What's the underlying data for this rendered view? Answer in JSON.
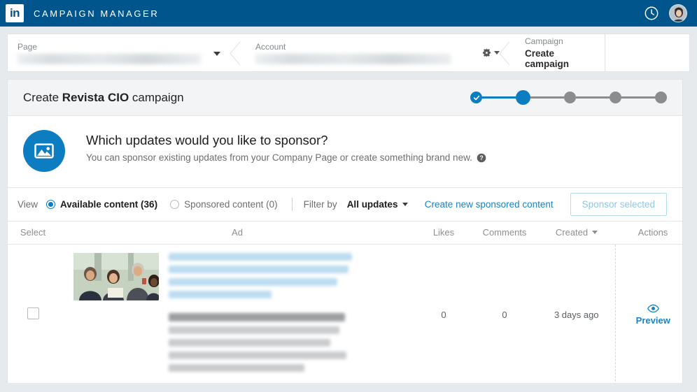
{
  "appbar": {
    "logo_text": "in",
    "title": "CAMPAIGN MANAGER",
    "clock_icon": "clock-icon",
    "avatar_icon": "user-avatar"
  },
  "breadcrumb": {
    "page": {
      "label": "Page",
      "value": "",
      "redacted": true,
      "caret_icon": "chevron-down-icon"
    },
    "account": {
      "label": "Account",
      "value": "",
      "redacted": true,
      "gear_icon": "gear-icon"
    },
    "campaign": {
      "label": "Campaign",
      "value": "Create campaign"
    }
  },
  "card_header": {
    "title_prefix": "Create ",
    "title_brand": "Revista CIO",
    "title_suffix": " campaign",
    "steps": [
      {
        "state": "done",
        "icon": "check-icon"
      },
      {
        "state": "active"
      },
      {
        "state": "pending"
      },
      {
        "state": "pending"
      },
      {
        "state": "pending"
      }
    ]
  },
  "prompt": {
    "icon": "image-icon",
    "heading": "Which updates would you like to sponsor?",
    "subtext": "You can sponsor existing updates from your Company Page or create something brand new.",
    "help_icon": "help-circle-icon"
  },
  "toolbar": {
    "view_label": "View",
    "options": [
      {
        "label": "Available content (36)",
        "selected": true
      },
      {
        "label": "Sponsored content (0)",
        "selected": false
      }
    ],
    "filter_label": "Filter by",
    "filter_value": "All updates",
    "filter_caret_icon": "chevron-down-icon",
    "create_link": "Create new sponsored content",
    "sponsor_button": "Sponsor selected",
    "sponsor_button_disabled": true
  },
  "table": {
    "columns": [
      "Select",
      "Ad",
      "Likes",
      "Comments",
      "Created",
      "Actions"
    ],
    "sort_column": "Created",
    "rows": [
      {
        "selected": false,
        "thumbnail": "business-people-photo",
        "link_text_redacted": true,
        "title_redacted": true,
        "body_redacted": true,
        "likes": "0",
        "comments": "0",
        "created": "3 days ago",
        "action_label": "Preview",
        "action_icon": "eye-icon"
      }
    ]
  },
  "colors": {
    "brand_header": "#00558c",
    "accent_blue": "#0b7dc0",
    "link_blue": "#1a83c7",
    "page_bg": "#e7eaec",
    "step_inactive": "#8c8c8c"
  }
}
